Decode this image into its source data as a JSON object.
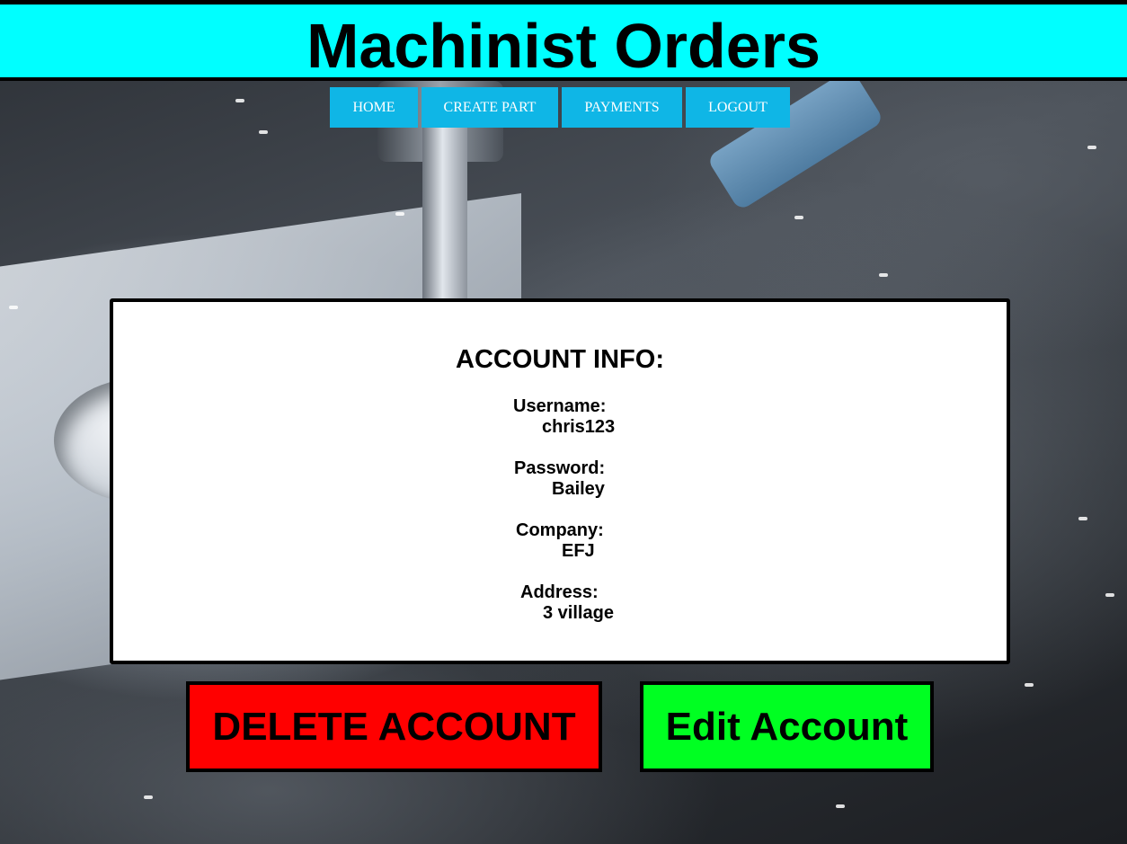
{
  "app": {
    "title": "Machinist Orders"
  },
  "nav": {
    "items": [
      {
        "label": "HOME"
      },
      {
        "label": "CREATE PART"
      },
      {
        "label": "PAYMENTS"
      },
      {
        "label": "LOGOUT"
      }
    ]
  },
  "account": {
    "heading": "ACCOUNT INFO:",
    "fields": [
      {
        "label": "Username:",
        "value": "chris123"
      },
      {
        "label": "Password:",
        "value": "Bailey"
      },
      {
        "label": "Company:",
        "value": "EFJ"
      },
      {
        "label": "Address:",
        "value": "3 village"
      }
    ]
  },
  "actions": {
    "delete_label": "DELETE ACCOUNT",
    "edit_label": "Edit Account"
  },
  "colors": {
    "header_bg": "#00ffff",
    "nav_bg": "#0fb6e6",
    "delete_bg": "#ff0000",
    "edit_bg": "#00ff22"
  }
}
